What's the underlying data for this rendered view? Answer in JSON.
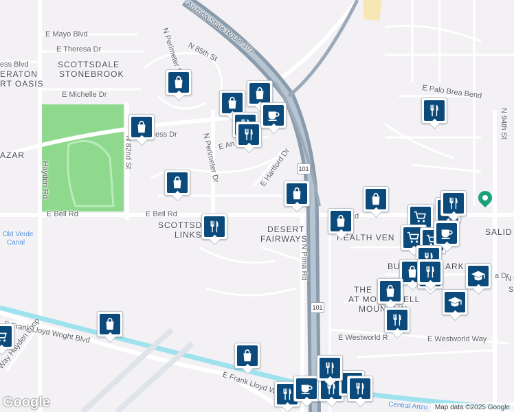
{
  "logo": "Google",
  "attribution": "Map data ©2025 Google",
  "colors": {
    "highway": "#9aaab9",
    "road": "#ffffff",
    "park": "#8fd98f",
    "canal": "#9ee2ee",
    "pin": "#0b4a7a",
    "poi_green": "#1aa179"
  },
  "area_labels": [
    "SCOTTSDALE",
    "STONEBROOK",
    "ERATON",
    "RT OASIS",
    "AZAR",
    "SCOTTSD",
    "LINKS",
    "DESERT",
    "FAIRWAYS",
    "HEALTH VEN",
    "BU",
    "ARK",
    "THE",
    "AT MO",
    "ELL",
    "MOUNTAIN",
    "SALID",
    "M"
  ],
  "street_labels": [
    "E Mayo Blvd",
    "E Theresa Dr",
    "N 85th St",
    "N Perimeter Dr",
    "ess Blvd",
    "E Michelle Dr",
    "ess Dr",
    "E An",
    "E Hartford Dr",
    "N 82nd St",
    "N Perimeter Dr",
    "Hayden Rd",
    "E Bell Rd",
    "E Bell Rd",
    "Rd",
    "E Palo Brea Bend",
    "N 94th St",
    "N Pima Rd",
    "a Dr",
    "E Westworld R",
    "E Westworld Way",
    "E Frank Lloyd Wright Blvd",
    "E Frank Lloyd W",
    "Way Hayden Loop",
    "N 9",
    "S"
  ],
  "water_labels": [
    "Old Verde",
    "Canal",
    "Central Arizo"
  ],
  "highway_labels": [
    "Arizona State Route 101"
  ],
  "shields": [
    "101",
    "101"
  ],
  "markers": [
    {
      "icon": "shopping-bag-icon"
    },
    {
      "icon": "shopping-bag-icon"
    },
    {
      "icon": "shopping-bag-icon"
    },
    {
      "icon": "shopping-bag-icon"
    },
    {
      "icon": "restaurant-icon"
    },
    {
      "icon": "restaurant-icon"
    },
    {
      "icon": "cafe-icon"
    },
    {
      "icon": "restaurant-icon"
    },
    {
      "icon": "shopping-bag-icon"
    },
    {
      "icon": "shopping-bag-icon"
    },
    {
      "icon": "shopping-bag-icon"
    },
    {
      "icon": "restaurant-icon"
    },
    {
      "icon": "shopping-bag-icon"
    },
    {
      "icon": "shopping-bag-icon"
    },
    {
      "icon": "restaurant-icon"
    },
    {
      "icon": "shopping-bag-icon"
    },
    {
      "icon": "shopping-cart-icon"
    },
    {
      "icon": "shopping-cart-icon"
    },
    {
      "icon": "shopping-cart-icon"
    },
    {
      "icon": "cafe-icon"
    },
    {
      "icon": "restaurant-icon"
    },
    {
      "icon": "shopping-bag-icon"
    },
    {
      "icon": "restaurant-icon"
    },
    {
      "icon": "graduation-cap-icon"
    },
    {
      "icon": "shopping-bag-icon"
    },
    {
      "icon": "graduation-cap-icon"
    },
    {
      "icon": "restaurant-icon"
    },
    {
      "icon": "shopping-bag-icon"
    },
    {
      "icon": "shopping-bag-icon"
    },
    {
      "icon": "shopping-cart-icon"
    },
    {
      "icon": "restaurant-icon"
    },
    {
      "icon": "cafe-icon"
    },
    {
      "icon": "restaurant-icon"
    },
    {
      "icon": "restaurant-icon"
    },
    {
      "icon": "restaurant-icon"
    },
    {
      "icon": "restaurant-icon"
    },
    {
      "icon": "restaurant-icon"
    }
  ]
}
